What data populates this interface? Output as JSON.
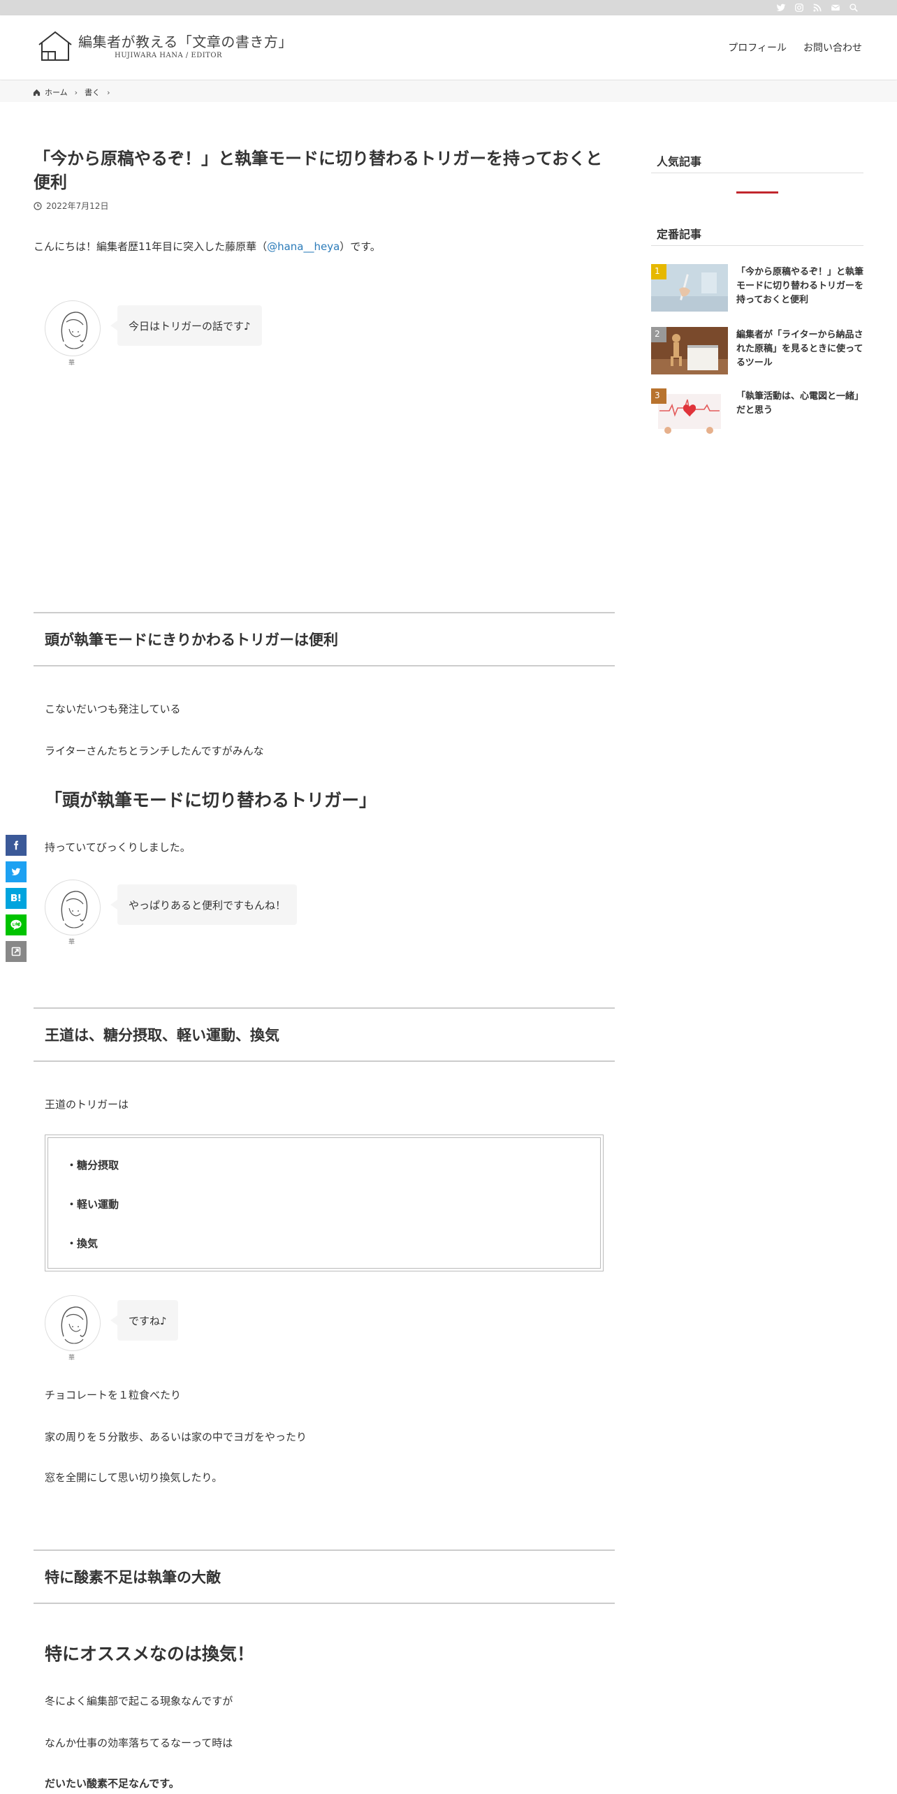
{
  "colors": {
    "accent": "#c1272d",
    "link": "#2b7bb9",
    "topbar": "#d9d9d9"
  },
  "topbar": {
    "icons": [
      "twitter-icon",
      "instagram-icon",
      "rss-icon",
      "mail-icon",
      "search-icon"
    ]
  },
  "header": {
    "logo_title": "編集者が教える「文章の書き方」",
    "logo_sub": "HUJIWARA HANA / EDITOR",
    "nav": [
      "プロフィール",
      "お問い合わせ"
    ]
  },
  "breadcrumb": [
    "ホーム",
    "書く"
  ],
  "post": {
    "title": "「今から原稿やるぞ！」と執筆モードに切り替わるトリガーを持っておくと便利",
    "date": "2022年7月12日",
    "intro_before": "こんにちは！編集者歴11年目に突入した藤原華（",
    "intro_link": "@hana__heya",
    "intro_after": "）です。",
    "avatar_name": "華",
    "balloons": [
      "今日はトリガーの話です♪",
      "やっぱりあると便利ですもんね！",
      "ですね♪"
    ],
    "headings": [
      "頭が執筆モードにきりかわるトリガーは便利",
      "王道は、糖分摂取、軽い運動、換気",
      "特に酸素不足は執筆の大敵"
    ],
    "p1": "こないだいつも発注している",
    "p2": "ライターさんたちとランチしたんですがみんな",
    "h3_1": "「頭が執筆モードに切り替わるトリガー」",
    "p3": "持っていてびっくりしました。",
    "p4": "王道のトリガーは",
    "list": [
      "・糖分摂取",
      "・軽い運動",
      "・換気"
    ],
    "p5": "チョコレートを１粒食べたり",
    "p6": "家の周りを５分散歩、あるいは家の中でヨガをやったり",
    "p7": "窓を全開にして思い切り換気したり。",
    "h3_2": "特にオススメなのは換気！",
    "p8": "冬によく編集部で起こる現象なんですが",
    "p9": "なんか仕事の効率落ちてるなーって時は",
    "p10": "だいたい酸素不足なんです。"
  },
  "share": [
    "f",
    "t",
    "B!",
    "LINE",
    "⇪"
  ],
  "sidebar": {
    "popular_title": "人気記事",
    "standard_title": "定番記事",
    "ranking": [
      {
        "num": "1",
        "title": "「今から原稿やるぞ！」と執筆モードに切り替わるトリガーを持っておくと便利"
      },
      {
        "num": "2",
        "title": "編集者が「ライターから納品された原稿」を見るときに使ってるツール"
      },
      {
        "num": "3",
        "title": "「執筆活動は、心電図と一緒」だと思う"
      }
    ]
  }
}
